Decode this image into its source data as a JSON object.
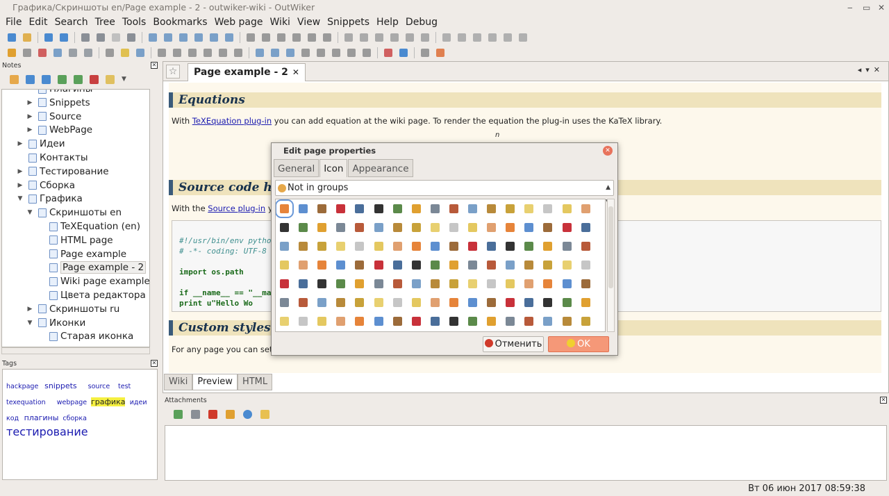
{
  "window": {
    "title": "Графика/Скриншоты en/Page example - 2 - outwiker-wiki - OutWiker",
    "controls": [
      "‒",
      "▭",
      "✕"
    ]
  },
  "menu": [
    "File",
    "Edit",
    "Search",
    "Tree",
    "Tools",
    "Bookmarks",
    "Web page",
    "Wiki",
    "View",
    "Snippets",
    "Help",
    "Debug"
  ],
  "notes_panel": {
    "title": "Notes",
    "tree": [
      {
        "label": "Плагины",
        "depth": 2,
        "arrow": ""
      },
      {
        "label": "Snippets",
        "depth": 2,
        "arrow": "▶"
      },
      {
        "label": "Source",
        "depth": 2,
        "arrow": "▶"
      },
      {
        "label": "WebPage",
        "depth": 2,
        "arrow": "▶"
      },
      {
        "label": "Идеи",
        "depth": 1,
        "arrow": "▶"
      },
      {
        "label": "Контакты",
        "depth": 1,
        "arrow": ""
      },
      {
        "label": "Тестирование",
        "depth": 1,
        "arrow": "▶"
      },
      {
        "label": "Сборка",
        "depth": 1,
        "arrow": "▶"
      },
      {
        "label": "Графика",
        "depth": 1,
        "arrow": "▼"
      },
      {
        "label": "Скриншоты en",
        "depth": 2,
        "arrow": "▼"
      },
      {
        "label": "TeXEquation (en)",
        "depth": 3,
        "arrow": ""
      },
      {
        "label": "HTML page",
        "depth": 3,
        "arrow": ""
      },
      {
        "label": "Page example",
        "depth": 3,
        "arrow": ""
      },
      {
        "label": "Page example - 2",
        "depth": 3,
        "arrow": "",
        "selected": true
      },
      {
        "label": "Wiki page example",
        "depth": 3,
        "arrow": ""
      },
      {
        "label": "Цвета редактора",
        "depth": 3,
        "arrow": ""
      },
      {
        "label": "Скриншоты ru",
        "depth": 2,
        "arrow": "▶"
      },
      {
        "label": "Иконки",
        "depth": 2,
        "arrow": "▼"
      },
      {
        "label": "Старая иконка",
        "depth": 3,
        "arrow": ""
      }
    ]
  },
  "tags_panel": {
    "title": "Tags",
    "tags": [
      {
        "label": "hackpage",
        "size": 9.5,
        "row": 0
      },
      {
        "label": "snippets",
        "size": 11,
        "row": 0
      },
      {
        "label": "source",
        "size": 9.5,
        "row": 0
      },
      {
        "label": "test",
        "size": 9.5,
        "row": 0
      },
      {
        "label": "texequation",
        "size": 9.5,
        "row": 1
      },
      {
        "label": "webpage",
        "size": 9.5,
        "row": 1
      },
      {
        "label": "графика",
        "size": 11,
        "row": 1,
        "highlight": true
      },
      {
        "label": "идеи",
        "size": 9.5,
        "row": 1
      },
      {
        "label": "код",
        "size": 9.5,
        "row": 2
      },
      {
        "label": "плагины",
        "size": 11,
        "row": 2
      },
      {
        "label": "сборка",
        "size": 9.5,
        "row": 2
      },
      {
        "label": "тестирование",
        "size": 16,
        "row": 3
      }
    ]
  },
  "editor": {
    "tab_label": "Page example - 2",
    "tab_close": "✕",
    "sections": [
      {
        "heading": "Equations"
      },
      {
        "heading": "Source code h"
      },
      {
        "heading": "Custom styles"
      }
    ],
    "para_equations": {
      "before": "With ",
      "link": "TeXEquation plug-in",
      "after": " you can add equation at the wiki page. To render the equation the plug-in uses the KaTeX library."
    },
    "para_source": {
      "before": "With the ",
      "link": "Source plug-in",
      "after": " yo"
    },
    "para_styles": "For any page you can set",
    "math_fragment": "n",
    "code_lines": [
      {
        "text": "#!/usr/bin/env pytho",
        "style": "comment"
      },
      {
        "text": "# -*- coding: UTF-8",
        "style": "comment"
      },
      {
        "text": "",
        "style": "plain"
      },
      {
        "text": "import os.path",
        "style": "import"
      },
      {
        "text": "",
        "style": "plain"
      },
      {
        "text": "if __name__ == \"__ma",
        "style": "if"
      },
      {
        "text": "    print u\"Hello Wo",
        "style": "print"
      }
    ],
    "mode_tabs": [
      {
        "label": "Wiki",
        "active": false
      },
      {
        "label": "Preview",
        "active": true
      },
      {
        "label": "HTML",
        "active": false
      }
    ]
  },
  "attachments_panel": {
    "title": "Attachments"
  },
  "status": {
    "datetime": "Вт 06 июн 2017 08:59:38"
  },
  "dialog": {
    "title": "Edit page properties",
    "tabs": [
      {
        "label": "General",
        "active": false
      },
      {
        "label": "Icon",
        "active": true
      },
      {
        "label": "Appearance",
        "active": false
      }
    ],
    "group_select": "Not in groups",
    "cancel_label": "Отменить",
    "ok_label": "OK",
    "icon_rows": [
      [
        "symbol",
        "page",
        "ball",
        "bug",
        "anchor",
        "terminal",
        "book",
        "star",
        "clip",
        "wand",
        "brush",
        "scale",
        "scale",
        "chat",
        "chat",
        "chat",
        "bandage"
      ],
      [
        "bank",
        "qr-code",
        "barcode",
        "basket",
        "bed",
        "bell",
        "bluetooth",
        "book",
        "bomb",
        "boomerang",
        "box",
        "box",
        "broom",
        "bug",
        "cactus",
        "calc",
        "calendar"
      ],
      [
        "camera",
        "cone",
        "cart",
        "chart",
        "chart",
        "cake",
        "chart",
        "tree",
        "globe",
        "chart",
        "pawn",
        "knight",
        "rook",
        "pen",
        "clock",
        "clock",
        "gear"
      ],
      [
        "palette",
        "note",
        "feather",
        "frame",
        "copyright",
        "card",
        "cup",
        "scissors",
        "cutlery",
        "cutlery",
        "pencil",
        "gauge",
        "feather",
        "door",
        "emoji",
        "code",
        "kanji"
      ],
      [
        "hash",
        "percent",
        "pilcrow",
        "quote",
        "omega",
        "pyramid",
        "mail",
        "scroll",
        "feather",
        "eye",
        "film",
        "film",
        "filter",
        "fingerprint",
        "fire",
        "extinguisher",
        "flame"
      ],
      [
        "bricks",
        "flask",
        "flask",
        "flower",
        "molecule",
        "globe",
        "guitar",
        "gun",
        "hat",
        "headphones",
        "heart",
        "house",
        "screen",
        "printer",
        "printer",
        "syringe",
        "board"
      ],
      [
        "chip",
        "window",
        "leaf",
        "lifebuoy",
        "link",
        "map",
        "metro",
        "music",
        "shroom",
        "shroom",
        "pin",
        "tape",
        "pill",
        "box",
        "clipboard",
        "paper",
        "palette"
      ]
    ],
    "icon_colors": [
      "#e6843a",
      "#5d8fd0",
      "#9c6b3a",
      "#c8313a",
      "#4a6e9a",
      "#333333",
      "#5b8a4a",
      "#e0a030",
      "#7b8896",
      "#b85a3a",
      "#7aa0c8",
      "#b88a3a",
      "#c8a23a",
      "#e8d070",
      "#c6c6c6",
      "#e4c860",
      "#e0a070"
    ]
  },
  "colors": {
    "accent": "#3a5b7a",
    "heading_bg": "#efe3bc",
    "link": "#1a1ab0",
    "ok_button": "#f59878",
    "cancel_icon": "#d03a2a",
    "ok_icon": "#f0d030"
  }
}
